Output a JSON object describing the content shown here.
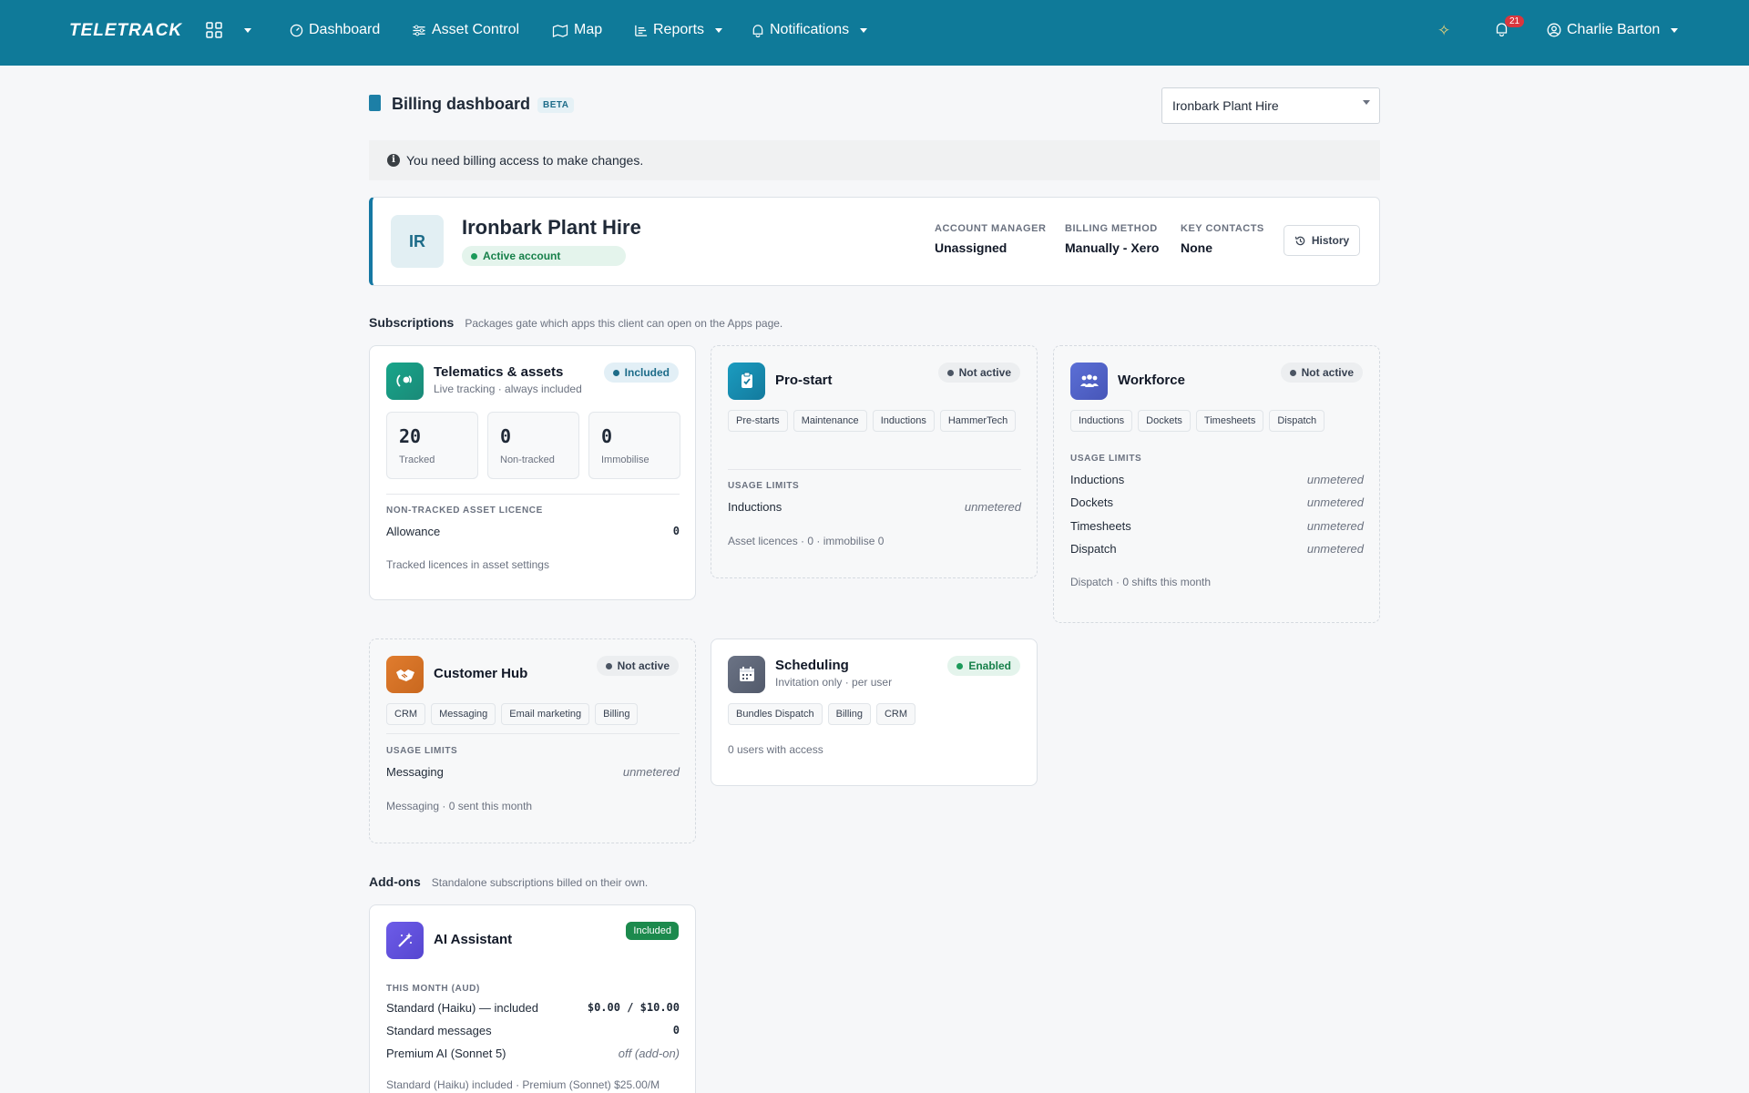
{
  "nav": {
    "logo": "TELETRACK",
    "items": [
      {
        "label": "Dashboard"
      },
      {
        "label": "Asset Control"
      },
      {
        "label": "Map"
      },
      {
        "label": "Reports"
      },
      {
        "label": "Notifications"
      }
    ],
    "notification_count": "21",
    "user_name": "Charlie Barton",
    "brand_color": "#0f7a99"
  },
  "page": {
    "title": "Billing dashboard",
    "beta": "BETA",
    "client_select": "Ironbark Plant Hire",
    "notice": "You need billing access to make changes."
  },
  "account": {
    "initials": "IR",
    "name": "Ironbark Plant Hire",
    "status": "Active account",
    "manager_label": "ACCOUNT MANAGER",
    "manager_value": "Unassigned",
    "billing_label": "BILLING METHOD",
    "billing_value": "Manually - Xero",
    "contacts_label": "KEY CONTACTS",
    "contacts_value": "None",
    "history_label": "History"
  },
  "subscriptions": {
    "heading": "Subscriptions",
    "subtitle": "Packages gate which apps this client can open on the Apps page.",
    "telematics": {
      "title": "Telematics & assets",
      "sub": "Live tracking · always included",
      "status": "Included",
      "stats": [
        {
          "n": "20",
          "l": "Tracked"
        },
        {
          "n": "0",
          "l": "Non-tracked"
        },
        {
          "n": "0",
          "l": "Immobilise"
        }
      ],
      "licence_label": "NON-TRACKED ASSET LICENCE",
      "allowance_label": "Allowance",
      "allowance_value": "0",
      "footer": "Tracked licences in asset settings"
    },
    "prestart": {
      "title": "Pro-start",
      "status": "Not active",
      "tags": [
        "Pre-starts",
        "Maintenance",
        "Inductions",
        "HammerTech"
      ],
      "usage_label": "USAGE LIMITS",
      "rows": [
        {
          "k": "Inductions",
          "v": "unmetered"
        }
      ],
      "footer": "Asset licences · 0 · immobilise 0"
    },
    "workforce": {
      "title": "Workforce",
      "status": "Not active",
      "tags": [
        "Inductions",
        "Dockets",
        "Timesheets",
        "Dispatch"
      ],
      "usage_label": "USAGE LIMITS",
      "rows": [
        {
          "k": "Inductions",
          "v": "unmetered"
        },
        {
          "k": "Dockets",
          "v": "unmetered"
        },
        {
          "k": "Timesheets",
          "v": "unmetered"
        },
        {
          "k": "Dispatch",
          "v": "unmetered"
        }
      ],
      "footer": "Dispatch · 0 shifts this month"
    },
    "customerhub": {
      "title": "Customer Hub",
      "status": "Not active",
      "tags": [
        "CRM",
        "Messaging",
        "Email marketing",
        "Billing"
      ],
      "usage_label": "USAGE LIMITS",
      "rows": [
        {
          "k": "Messaging",
          "v": "unmetered"
        }
      ],
      "footer": "Messaging · 0 sent this month"
    },
    "scheduling": {
      "title": "Scheduling",
      "sub": "Invitation only · per user",
      "status": "Enabled",
      "tags": [
        "Bundles Dispatch",
        "Billing",
        "CRM"
      ],
      "footer": "0 users with access"
    }
  },
  "addons": {
    "heading": "Add-ons",
    "subtitle": "Standalone subscriptions billed on their own.",
    "ai": {
      "title": "AI Assistant",
      "status": "Included",
      "month_label": "THIS MONTH (AUD)",
      "rows": [
        {
          "k": "Standard (Haiku) — included",
          "v": "$0.00 / $10.00"
        },
        {
          "k": "Standard messages",
          "v": "0"
        },
        {
          "k": "Premium AI (Sonnet 5)",
          "v": "off (add-on)"
        }
      ],
      "footer": "Standard (Haiku) included · Premium (Sonnet) $25.00/M"
    }
  },
  "icons": [
    "grid-icon",
    "dashboard-icon",
    "sliders-icon",
    "map-icon",
    "reports-icon",
    "bell-icon",
    "sparkle-icon",
    "user-icon",
    "history-icon",
    "info-icon"
  ]
}
